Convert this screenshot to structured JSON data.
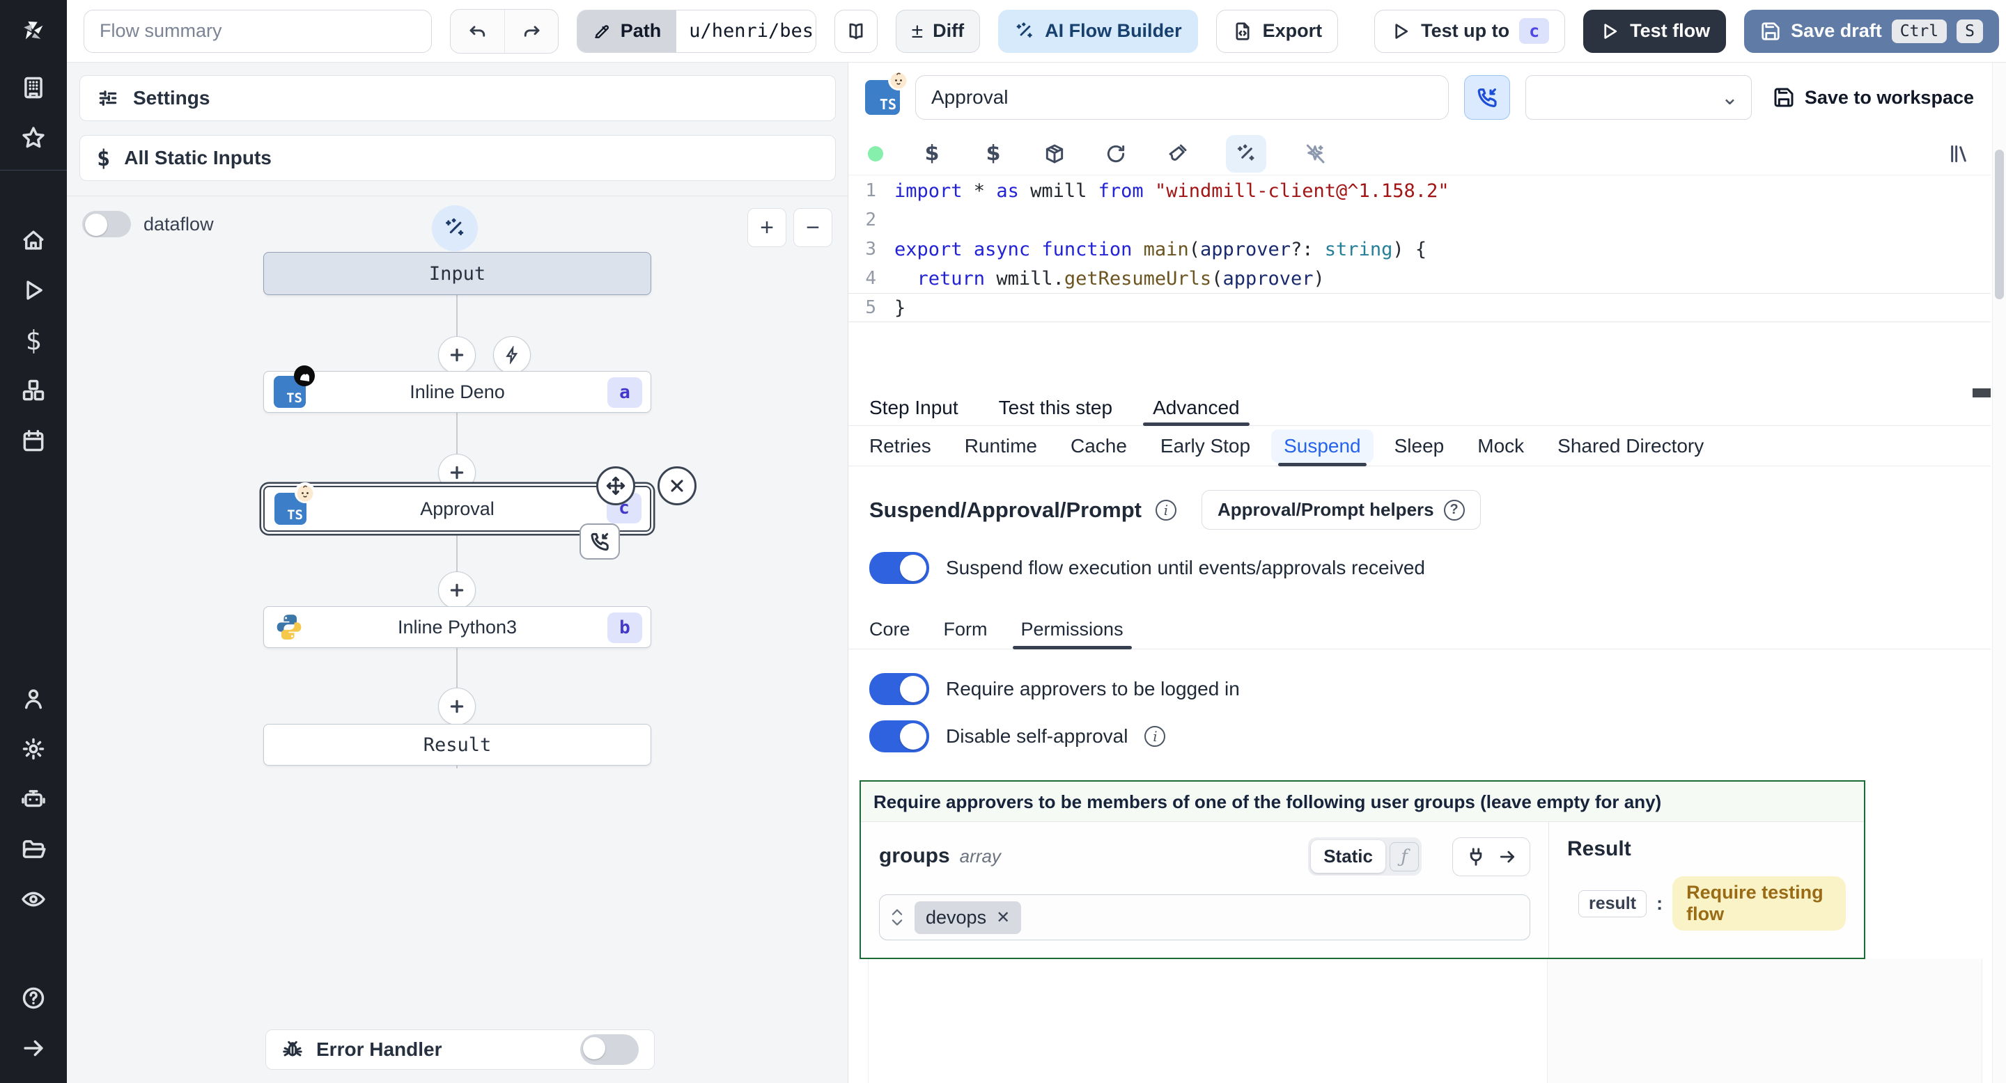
{
  "topbar": {
    "flow_summary_placeholder": "Flow summary",
    "path_label": "Path",
    "path_value": "u/henri/bes",
    "diff_label": "Diff",
    "diff_glyph": "±",
    "ai_flow_builder_label": "AI Flow Builder",
    "export_label": "Export",
    "test_up_to_label": "Test up to",
    "test_up_to_badge": "c",
    "test_flow_label": "Test flow",
    "save_draft_label": "Save draft",
    "save_draft_shortcut": [
      "Ctrl",
      "S"
    ]
  },
  "flow_panel": {
    "settings_label": "Settings",
    "static_inputs_label": "All Static Inputs",
    "dataflow_label": "dataflow",
    "zoom_in_label": "+",
    "zoom_out_label": "−",
    "nodes": {
      "input_label": "Input",
      "deno": {
        "label": "Inline Deno",
        "badge": "a",
        "icon": "typescript-deno"
      },
      "approval": {
        "label": "Approval",
        "badge": "c",
        "icon": "typescript-emoji"
      },
      "python": {
        "label": "Inline Python3",
        "badge": "b",
        "icon": "python"
      },
      "result_label": "Result"
    },
    "error_handler_label": "Error Handler"
  },
  "editor": {
    "step_name": "Approval",
    "save_to_workspace_label": "Save to workspace",
    "status_dot_color": "#86efac",
    "code": {
      "current_line": "5",
      "lines": [
        {
          "n": "1",
          "segs": [
            [
              "kw",
              "import"
            ],
            [
              "pl",
              " * "
            ],
            [
              "kw",
              "as"
            ],
            [
              "pl",
              " wmill "
            ],
            [
              "kw",
              "from"
            ],
            [
              "pl",
              " "
            ],
            [
              "str",
              "\"windmill-client@^1.158.2\""
            ]
          ]
        },
        {
          "n": "2",
          "segs": []
        },
        {
          "n": "3",
          "segs": [
            [
              "kw",
              "export"
            ],
            [
              "pl",
              " "
            ],
            [
              "kw",
              "async"
            ],
            [
              "pl",
              " "
            ],
            [
              "kw",
              "function"
            ],
            [
              "pl",
              " "
            ],
            [
              "fn",
              "main"
            ],
            [
              "pl",
              "("
            ],
            [
              "var",
              "approver"
            ],
            [
              "pl",
              "?: "
            ],
            [
              "ty",
              "string"
            ],
            [
              "pl",
              ") {"
            ]
          ]
        },
        {
          "n": "4",
          "segs": [
            [
              "pl",
              "  "
            ],
            [
              "kw",
              "return"
            ],
            [
              "pl",
              " wmill."
            ],
            [
              "fn",
              "getResumeUrls"
            ],
            [
              "pl",
              "("
            ],
            [
              "var",
              "approver"
            ],
            [
              "pl",
              ")"
            ]
          ]
        },
        {
          "n": "5",
          "segs": [
            [
              "pl",
              "}"
            ]
          ]
        }
      ]
    },
    "tabs": [
      "Step Input",
      "Test this step",
      "Advanced"
    ],
    "active_tab": "Advanced",
    "subtabs": [
      "Retries",
      "Runtime",
      "Cache",
      "Early Stop",
      "Suspend",
      "Sleep",
      "Mock",
      "Shared Directory"
    ],
    "active_subtab": "Suspend",
    "suspend": {
      "heading": "Suspend/Approval/Prompt",
      "helpers_label": "Approval/Prompt helpers",
      "suspend_toggle_label": "Suspend flow execution until events/approvals received",
      "inner_tabs": [
        "Core",
        "Form",
        "Permissions"
      ],
      "active_inner_tab": "Permissions",
      "require_logged_in_label": "Require approvers to be logged in",
      "disable_self_approval_label": "Disable self-approval",
      "groups_box": {
        "title": "Require approvers to be members of one of the following user groups (leave empty for any)",
        "field_name": "groups",
        "field_type": "array",
        "static_label": "Static",
        "fx_glyph": "ƒ",
        "tag": "devops",
        "tag_remove_glyph": "✕",
        "border_color": "#1d6b35"
      },
      "result": {
        "heading": "Result",
        "key": "result",
        "colon": ":",
        "value": "Require testing flow",
        "value_bg": "#fbf3c8",
        "value_color": "#9a6b15"
      }
    }
  },
  "colors": {
    "accent_blue": "#2f62df",
    "toolbar_dark": "#2b3240",
    "save_draft_steel": "#5f7ba6",
    "ai_builder_bg": "#d7eafc",
    "badge_bg": "#dfe3fc",
    "badge_text": "#4338ca",
    "selected_node_border": "#3b4453"
  }
}
